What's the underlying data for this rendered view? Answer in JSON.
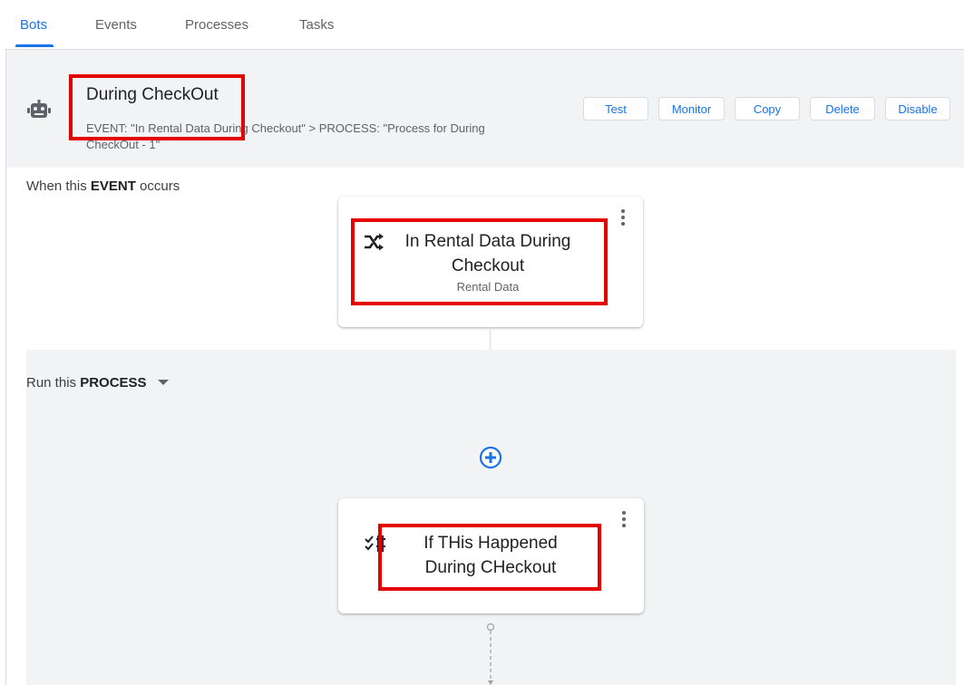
{
  "tabs": [
    {
      "label": "Bots",
      "active": true
    },
    {
      "label": "Events",
      "active": false
    },
    {
      "label": "Processes",
      "active": false
    },
    {
      "label": "Tasks",
      "active": false
    }
  ],
  "header": {
    "icon": "robot-icon",
    "title": "During CheckOut",
    "subtitle": "EVENT: \"In Rental Data During Checkout\" > PROCESS: \"Process for During CheckOut - 1\"",
    "buttons": [
      "Test",
      "Monitor",
      "Copy",
      "Delete",
      "Disable"
    ]
  },
  "event_section": {
    "prefix": "When this ",
    "keyword": "EVENT",
    "suffix": " occurs",
    "card": {
      "icon": "shuffle-icon",
      "title_line1": "In Rental Data During",
      "title_line2": "Checkout",
      "subtitle": "Rental Data"
    }
  },
  "process_section": {
    "prefix": "Run this ",
    "keyword": "PROCESS",
    "add_icon": "add-circle-icon",
    "card": {
      "icon": "checklist-icon",
      "title_line1": "If THis Happened",
      "title_line2": "During CHeckout"
    }
  },
  "colors": {
    "accent": "#1a73e8",
    "highlight": "#e50000",
    "header_bg": "#f1f3f4"
  }
}
